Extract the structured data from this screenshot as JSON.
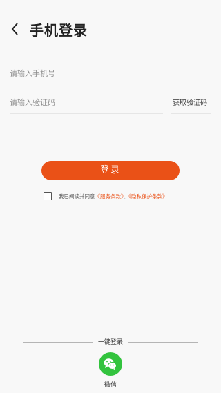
{
  "header": {
    "title": "手机登录"
  },
  "form": {
    "phone_placeholder": "请输入手机号",
    "code_placeholder": "请输入验证码",
    "get_code_label": "获取验证码",
    "login_label": "登录"
  },
  "agreement": {
    "prefix": "我已阅读并同意",
    "service_link": "《服务条款》",
    "separator": "、",
    "privacy_link": "《隐私保护条款》"
  },
  "oneclick": {
    "label": "一键登录",
    "wechat_label": "微信"
  },
  "colors": {
    "accent": "#ea5117",
    "wechat": "#33c33e"
  },
  "icons": {
    "back": "chevron-left-icon",
    "wechat": "wechat-icon"
  }
}
